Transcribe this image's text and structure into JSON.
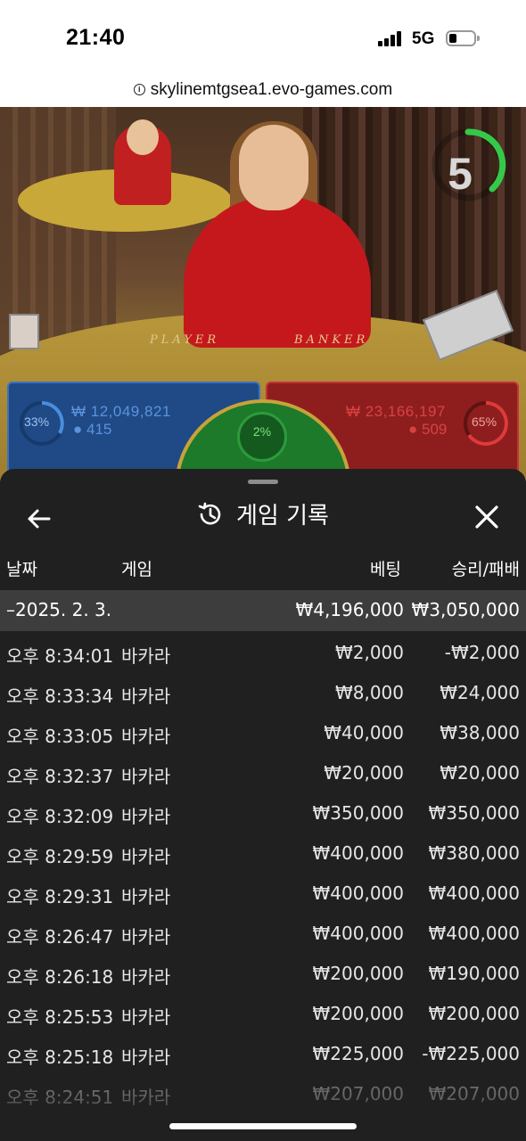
{
  "status_bar": {
    "time": "21:40",
    "network": "5G"
  },
  "browser": {
    "url": "skylinemtgsea1.evo-games.com"
  },
  "game": {
    "countdown": "5",
    "table_labels": {
      "player": "PLAYER",
      "banker": "BANKER"
    },
    "player_bet": {
      "percent": "33%",
      "amount": "₩ 12,049,821",
      "players": "415"
    },
    "banker_bet": {
      "percent": "65%",
      "amount": "₩ 23,166,197",
      "players": "509"
    },
    "tie_bet": {
      "percent": "2%"
    },
    "colors": {
      "player": "#1f4a85",
      "banker": "#8e1e1e",
      "tie": "#1c7a2a"
    }
  },
  "history": {
    "title": "게임 기록",
    "columns": {
      "date": "날짜",
      "game": "게임",
      "bet": "베팅",
      "win_loss": "승리/패배"
    },
    "date_group": {
      "label": "–2025. 2. 3.",
      "bet_total": "₩4,196,000",
      "win_total": "₩3,050,000"
    },
    "rows": [
      {
        "time": "오후 8:34:01",
        "game": "바카라",
        "bet": "₩2,000",
        "result": "-₩2,000"
      },
      {
        "time": "오후 8:33:34",
        "game": "바카라",
        "bet": "₩8,000",
        "result": "₩24,000"
      },
      {
        "time": "오후 8:33:05",
        "game": "바카라",
        "bet": "₩40,000",
        "result": "₩38,000"
      },
      {
        "time": "오후 8:32:37",
        "game": "바카라",
        "bet": "₩20,000",
        "result": "₩20,000"
      },
      {
        "time": "오후 8:32:09",
        "game": "바카라",
        "bet": "₩350,000",
        "result": "₩350,000"
      },
      {
        "time": "오후 8:29:59",
        "game": "바카라",
        "bet": "₩400,000",
        "result": "₩380,000"
      },
      {
        "time": "오후 8:29:31",
        "game": "바카라",
        "bet": "₩400,000",
        "result": "₩400,000"
      },
      {
        "time": "오후 8:26:47",
        "game": "바카라",
        "bet": "₩400,000",
        "result": "₩400,000"
      },
      {
        "time": "오후 8:26:18",
        "game": "바카라",
        "bet": "₩200,000",
        "result": "₩190,000"
      },
      {
        "time": "오후 8:25:53",
        "game": "바카라",
        "bet": "₩200,000",
        "result": "₩200,000"
      },
      {
        "time": "오후 8:25:18",
        "game": "바카라",
        "bet": "₩225,000",
        "result": "-₩225,000"
      },
      {
        "time": "오후 8:24:51",
        "game": "바카라",
        "bet": "₩207,000",
        "result": "₩207,000"
      }
    ]
  }
}
